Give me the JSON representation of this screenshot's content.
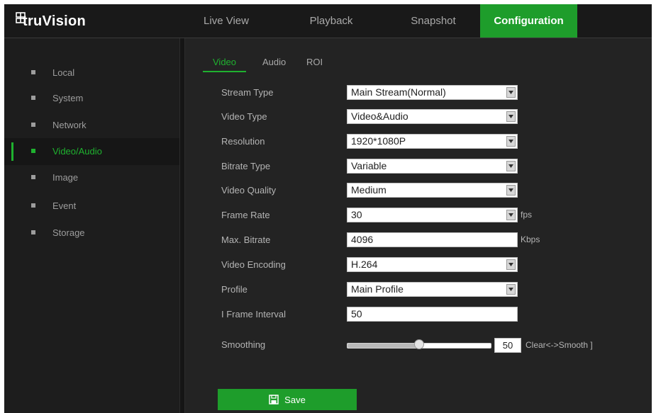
{
  "app": {
    "logo_text": "truVision"
  },
  "nav": {
    "tabs": [
      {
        "label": "Live View"
      },
      {
        "label": "Playback"
      },
      {
        "label": "Snapshot"
      },
      {
        "label": "Configuration",
        "active": true
      }
    ]
  },
  "sidebar": {
    "items": [
      {
        "label": "Local"
      },
      {
        "label": "System"
      },
      {
        "label": "Network"
      },
      {
        "label": "Video/Audio",
        "active": true
      },
      {
        "label": "Image"
      },
      {
        "label": "Event"
      },
      {
        "label": "Storage"
      }
    ]
  },
  "subtabs": [
    {
      "label": "Video",
      "active": true
    },
    {
      "label": "Audio"
    },
    {
      "label": "ROI"
    }
  ],
  "form": {
    "stream_type": {
      "label": "Stream Type",
      "value": "Main Stream(Normal)"
    },
    "video_type": {
      "label": "Video Type",
      "value": "Video&Audio"
    },
    "resolution": {
      "label": "Resolution",
      "value": "1920*1080P"
    },
    "bitrate_type": {
      "label": "Bitrate Type",
      "value": "Variable"
    },
    "video_quality": {
      "label": "Video Quality",
      "value": "Medium"
    },
    "frame_rate": {
      "label": "Frame Rate",
      "value": "30",
      "unit": "fps"
    },
    "max_bitrate": {
      "label": "Max. Bitrate",
      "value": "4096",
      "unit": "Kbps"
    },
    "video_encoding": {
      "label": "Video Encoding",
      "value": "H.264"
    },
    "profile": {
      "label": "Profile",
      "value": "Main Profile"
    },
    "i_frame_interval": {
      "label": "I Frame Interval",
      "value": "50"
    },
    "smoothing": {
      "label": "Smoothing",
      "value": "50",
      "level": 0.5,
      "hint": "Clear<->Smooth ]"
    }
  },
  "save": {
    "label": "Save"
  },
  "colors": {
    "accent": "#1e9d2b",
    "background": "#232323",
    "sidebar": "#1d1d1d"
  }
}
